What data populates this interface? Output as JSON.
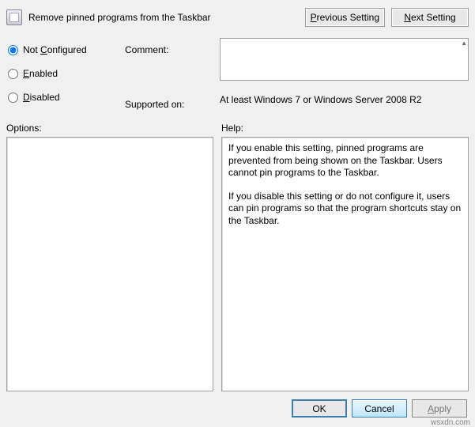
{
  "header": {
    "title": "Remove pinned programs from the Taskbar",
    "previous_label": "Previous Setting",
    "next_label": "Next Setting"
  },
  "states": {
    "not_configured": "Not Configured",
    "enabled": "Enabled",
    "disabled": "Disabled",
    "selected": "not_configured"
  },
  "fields": {
    "comment_label": "Comment:",
    "comment_value": "",
    "supported_label": "Supported on:",
    "supported_value": "At least Windows 7 or Windows Server 2008 R2"
  },
  "sections": {
    "options_label": "Options:",
    "help_label": "Help:"
  },
  "help": {
    "p1": "If you enable this setting, pinned programs are prevented from being shown on the Taskbar. Users cannot pin programs to the Taskbar.",
    "p2": "If you disable this setting or do not configure it, users can pin programs so that the program shortcuts stay on the Taskbar."
  },
  "buttons": {
    "ok": "OK",
    "cancel": "Cancel",
    "apply": "Apply"
  },
  "watermark": "wsxdn.com"
}
